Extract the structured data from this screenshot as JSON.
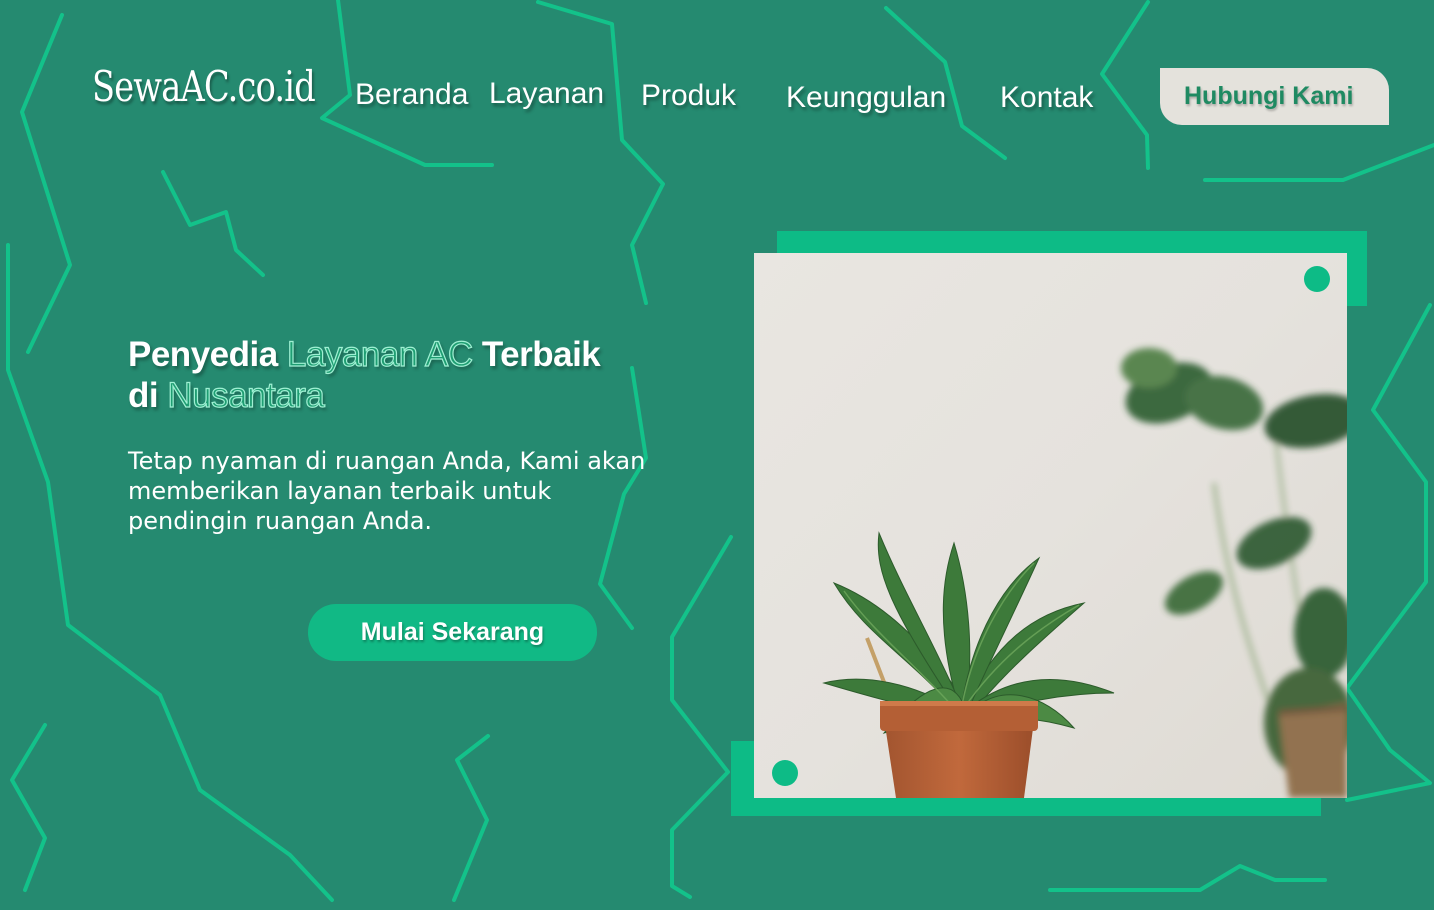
{
  "brand": {
    "logo_text": "SewaAC.co.id"
  },
  "nav": {
    "items": [
      {
        "label": "Beranda"
      },
      {
        "label": "Layanan"
      },
      {
        "label": "Produk"
      },
      {
        "label": "Keunggulan"
      },
      {
        "label": "Kontak"
      }
    ],
    "contact_button": "Hubungi Kami"
  },
  "hero": {
    "headline": {
      "part1": "Penyedia ",
      "highlight1": "Layanan AC",
      "part2": " Terbaik",
      "part3": "di ",
      "highlight2": "Nusantara"
    },
    "description": "Tetap nyaman di ruangan Anda, Kami akan memberikan layanan terbaik untuk pendingin ruangan Anda.",
    "cta_label": "Mulai Sekarang"
  },
  "colors": {
    "background": "#258a70",
    "accent": "#0dbb86",
    "line": "#13c28a",
    "button_light": "#e4e2dc"
  },
  "icons": {
    "image_subject": "potted-plant-image"
  }
}
